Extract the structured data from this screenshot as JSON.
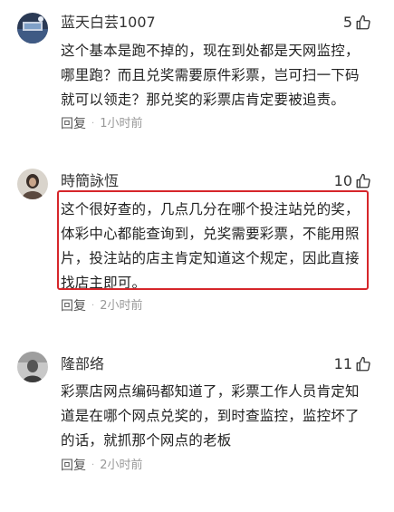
{
  "colors": {
    "highlight_border": "#d6262a",
    "meta_text": "#888888",
    "body_text": "#222222"
  },
  "comments": [
    {
      "username": "蓝天白芸1007",
      "likes": "5",
      "like_icon": "thumbs-up-icon",
      "lines": [
        "这个基本是跑不掉的，现在到处都是天网监控，",
        "哪里跑？而且兑奖需要原件彩票，岂可扫一下码",
        "就可以领走？那兑奖的彩票店肯定要被追责。"
      ],
      "reply_label": "回复",
      "separator": "·",
      "time": "1小时前"
    },
    {
      "username": "時簡詠恆",
      "likes": "10",
      "like_icon": "thumbs-up-icon",
      "lines": [
        "这个很好查的，几点几分在哪个投注站兑的奖，",
        "体彩中心都能查询到，兑奖需要彩票，不能用照",
        "片，投注站的店主肯定知道这个规定，因此直接",
        "找店主即可。"
      ],
      "reply_label": "回复",
      "separator": "·",
      "time": "2小时前"
    },
    {
      "username": "隆部络",
      "likes": "11",
      "like_icon": "thumbs-up-icon",
      "lines": [
        "彩票店网点编码都知道了，彩票工作人员肯定知",
        "道是在哪个网点兑奖的，到时查监控，监控坏了",
        "的话，就抓那个网点的老板"
      ],
      "reply_label": "回复",
      "separator": "·",
      "time": "2小时前"
    }
  ]
}
